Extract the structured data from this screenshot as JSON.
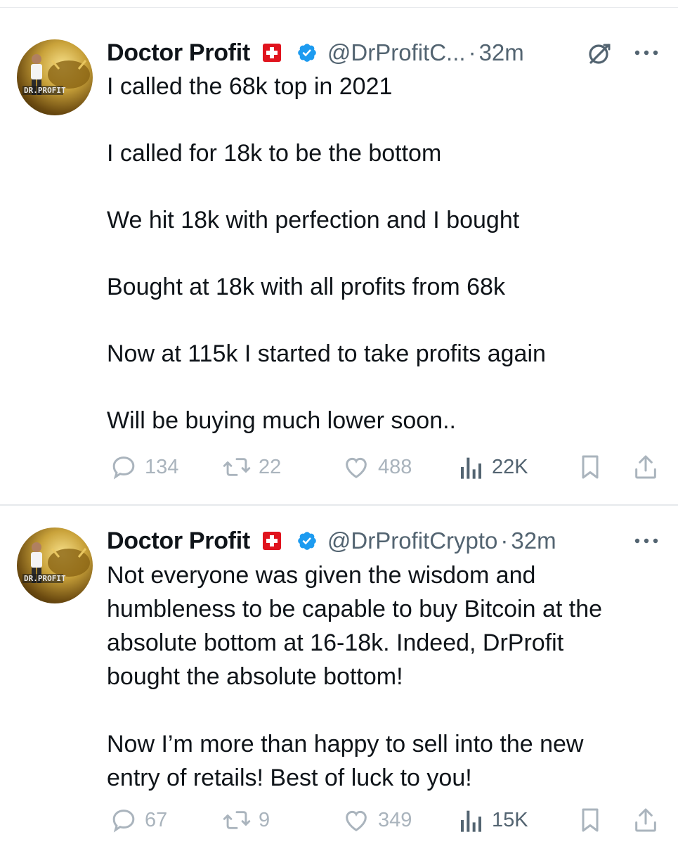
{
  "tweets": [
    {
      "author": {
        "name": "Doctor Profit",
        "flag": "swiss-flag",
        "verified": true,
        "handle": "@DrProfitC...",
        "avatar_text": "DR.PROFIT"
      },
      "separator": "·",
      "time": "32m",
      "has_grok_icon": true,
      "text": "I called the 68k top in 2021\n\nI called for 18k to be the bottom\n\nWe hit 18k with perfection and I bought\n\nBought at 18k with all profits from 68k\n\nNow at 115k I started to take profits again\n\nWill be buying much lower soon..",
      "stats": {
        "replies": "134",
        "retweets": "22",
        "likes": "488",
        "views": "22K"
      }
    },
    {
      "author": {
        "name": "Doctor Profit",
        "flag": "swiss-flag",
        "verified": true,
        "handle": "@DrProfitCrypto",
        "avatar_text": "DR.PROFIT"
      },
      "separator": "·",
      "time": "32m",
      "has_grok_icon": false,
      "text": "Not everyone was given the wisdom and\nhumbleness to be capable to buy Bitcoin at the\nabsolute bottom at 16-18k. Indeed, DrProfit\nbought the absolute bottom!\n\nNow I’m more than happy to sell into the new\nentry of retails! Best of luck to you!",
      "stats": {
        "replies": "67",
        "retweets": "9",
        "likes": "349",
        "views": "15K"
      }
    }
  ],
  "colors": {
    "text": "#0f1419",
    "muted": "#536471",
    "faded": "#aab4bd",
    "verified_blue": "#1d9bf0",
    "flag_red": "#e0141e",
    "divider": "#e6e9ec"
  }
}
